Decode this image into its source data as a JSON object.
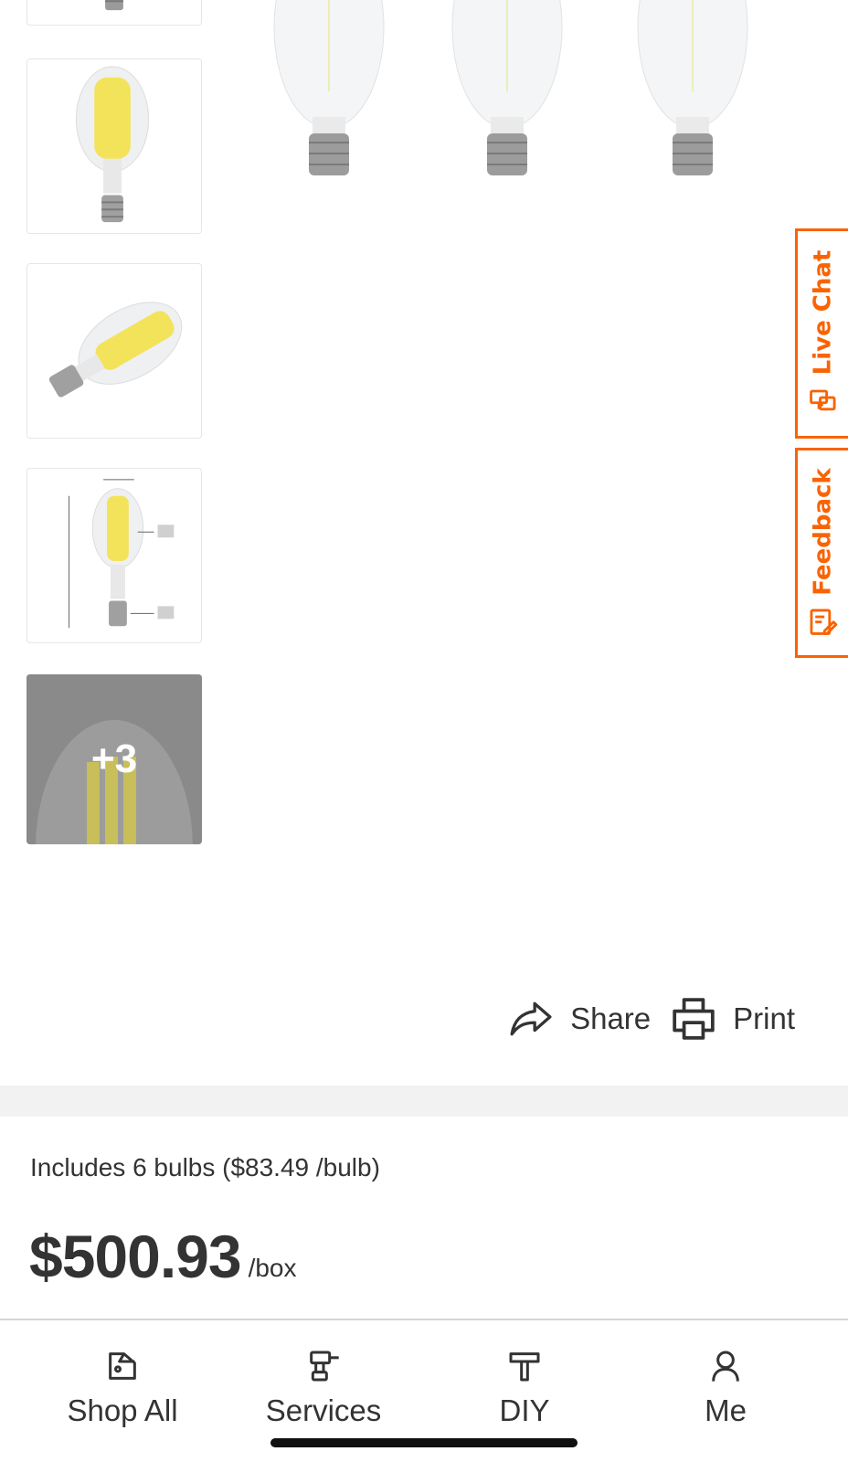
{
  "thumbnails": {
    "more_label": "+3"
  },
  "side_tabs": {
    "live_chat_label": "Live Chat",
    "feedback_label": "Feedback"
  },
  "actions": {
    "share_label": "Share",
    "print_label": "Print"
  },
  "product": {
    "bulb_note": "Includes 6 bulbs ($83.49 /bulb)",
    "price": "$500.93",
    "price_unit": "/box"
  },
  "nav": {
    "shop_all_label": "Shop All",
    "services_label": "Services",
    "diy_label": "DIY",
    "me_label": "Me"
  },
  "colors": {
    "accent": "#f96302",
    "text": "#333333",
    "bulb_filament": "#f3e35a"
  },
  "icons": {
    "share": "share-arrow-icon",
    "print": "printer-icon",
    "shop_all": "shopping-tag-icon",
    "services": "drill-icon",
    "diy": "hammer-icon",
    "me": "person-icon",
    "live_chat": "chat-bubbles-icon",
    "feedback": "feedback-edit-icon"
  }
}
